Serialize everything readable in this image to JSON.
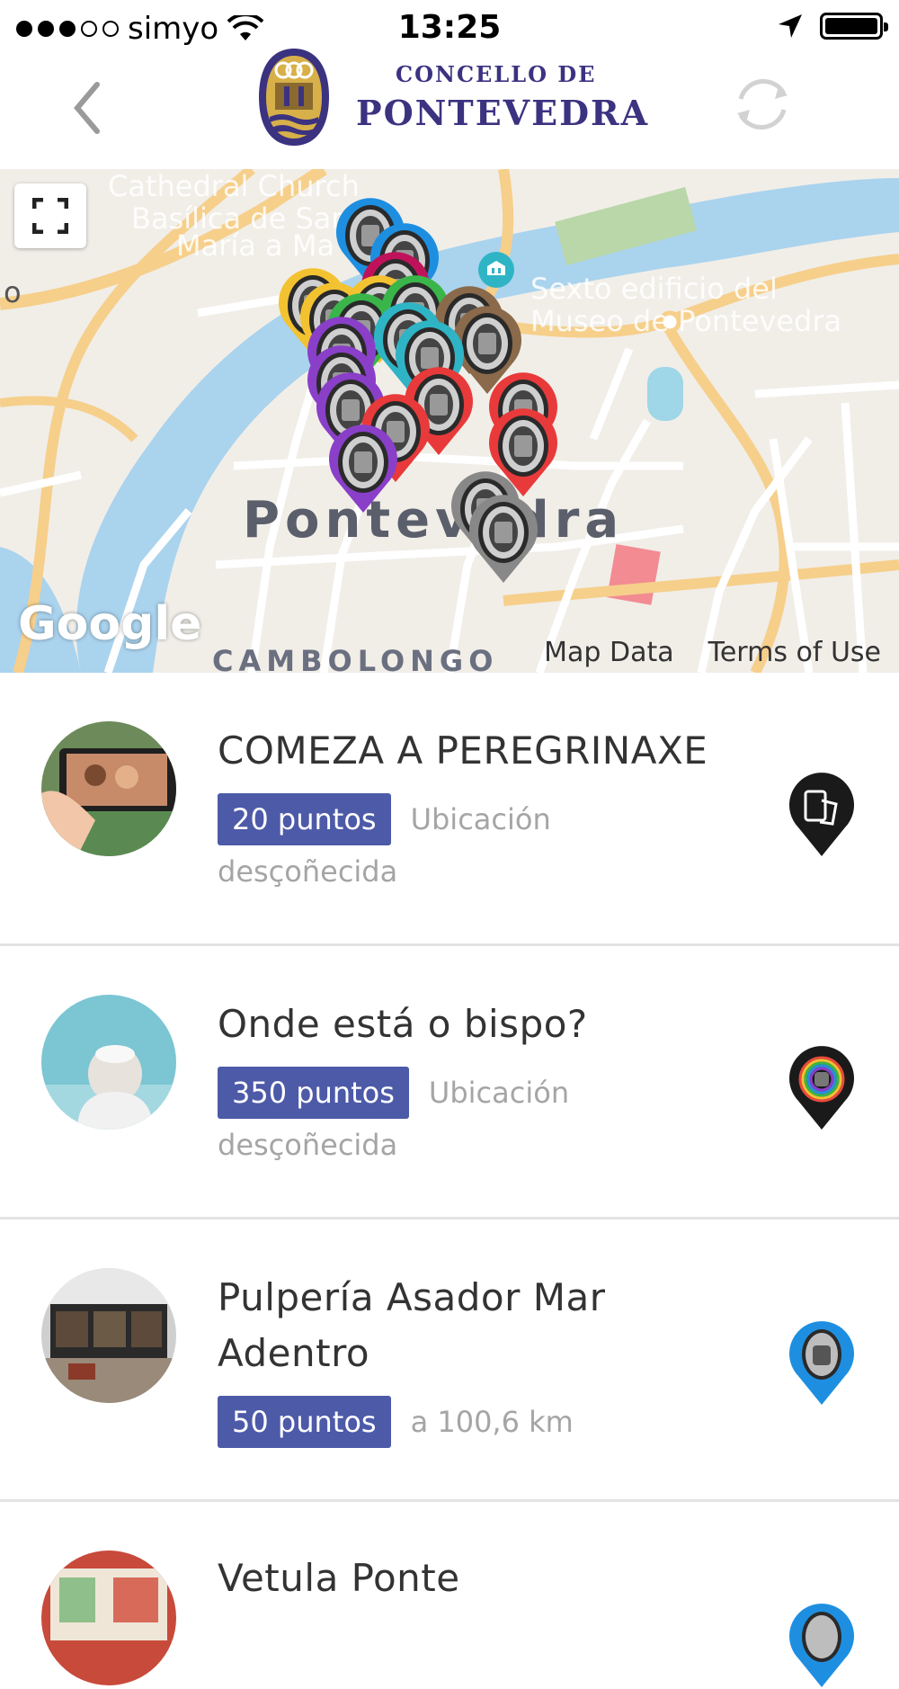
{
  "status_bar": {
    "carrier": "simyo",
    "time": "13:25"
  },
  "header": {
    "logo_line1": "CONCELLO DE",
    "logo_line2": "PONTEVEDRA",
    "back_icon": "chevron-left-icon",
    "refresh_icon": "refresh-icon"
  },
  "map": {
    "labels": {
      "church": "Cathedral Church",
      "basilica_1": "Basílica de San",
      "basilica_2": "María a Ma",
      "museum_1": "Sexto edificio del",
      "museum_2": "Museo de Pontevedra",
      "left_o": "o",
      "city": "Pontevedra",
      "district": "CAMBOLONGO"
    },
    "google": "Google",
    "map_data": "Map Data",
    "terms": "Terms of Use"
  },
  "colors": {
    "badge": "#4d5aa8",
    "logo_blue": "#3b3280"
  },
  "items": [
    {
      "title": "COMEZA A PEREGRINAXE",
      "points": "20 puntos",
      "location": "Ubicación desçoñecida",
      "marker": "dark-phone-pin-icon"
    },
    {
      "title": "Onde está o bispo?",
      "points": "350 puntos",
      "location": "Ubicación desçoñecida",
      "marker": "rainbow-pin-icon"
    },
    {
      "title": "Pulpería Asador Mar Adentro",
      "points": "50 puntos",
      "location": "a 100,6 km",
      "marker": "blue-pin-icon"
    },
    {
      "title": "Vetula Ponte",
      "marker": "blue-pin-icon"
    }
  ]
}
